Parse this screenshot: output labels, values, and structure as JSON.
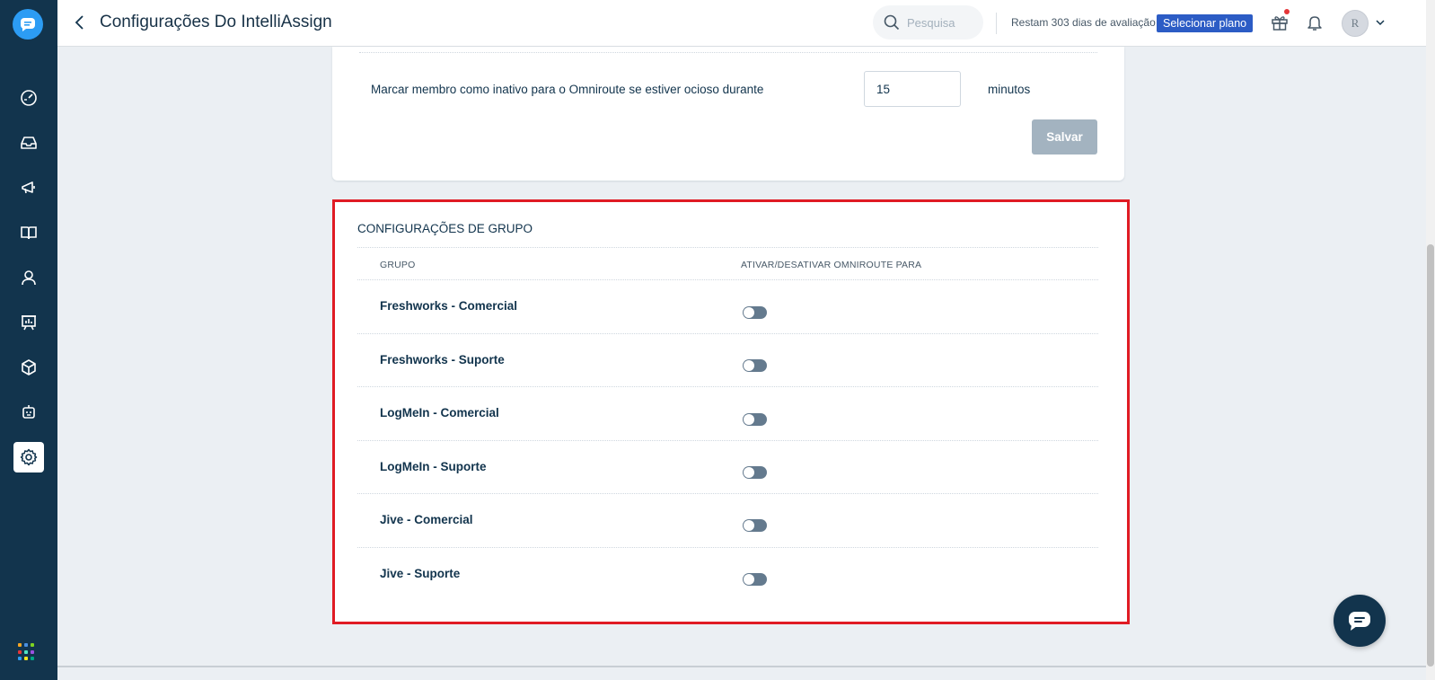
{
  "header": {
    "title": "Configurações Do IntelliAssign",
    "search_placeholder": "Pesquisa",
    "trial_text": "Restam 303 dias de avaliação",
    "plan_button": "Selecionar plano",
    "avatar_initial": "R"
  },
  "sidebar": {
    "items": [
      "dashboard-icon",
      "inbox-icon",
      "megaphone-icon",
      "book-icon",
      "contact-icon",
      "analytics-icon",
      "box-icon",
      "bot-icon",
      "gear-icon"
    ],
    "active": "gear-icon"
  },
  "idle_settings": {
    "label": "Marcar membro como inativo para o Omniroute se estiver ocioso durante",
    "value": "15",
    "unit": "minutos",
    "save_label": "Salvar"
  },
  "group_settings": {
    "title": "CONFIGURAÇÕES DE GRUPO",
    "col_group": "GRUPO",
    "col_toggle": "ATIVAR/DESATIVAR OMNIROUTE PARA",
    "rows": [
      {
        "name": "Freshworks - Comercial",
        "enabled": false
      },
      {
        "name": "Freshworks - Suporte",
        "enabled": false
      },
      {
        "name": "LogMeIn - Comercial",
        "enabled": false
      },
      {
        "name": "LogMeIn - Suporte",
        "enabled": false
      },
      {
        "name": "Jive - Comercial",
        "enabled": false
      },
      {
        "name": "Jive - Suporte",
        "enabled": false
      }
    ]
  },
  "colors": {
    "sidebar_bg": "#12344d",
    "primary": "#2c5cc5",
    "highlight_border": "#e01b24",
    "toggle_off": "#647a8e",
    "save_disabled": "#a3b3c0"
  }
}
